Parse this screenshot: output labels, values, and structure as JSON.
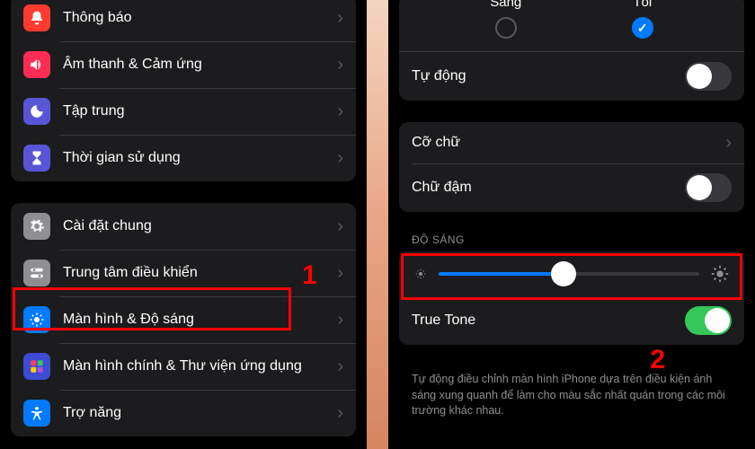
{
  "left": {
    "group1": [
      {
        "label": "Thông báo",
        "color": "#ff3b30",
        "icon": "bell"
      },
      {
        "label": "Âm thanh & Cảm ứng",
        "color": "#ff2d55",
        "icon": "speaker"
      },
      {
        "label": "Tập trung",
        "color": "#5856d6",
        "icon": "moon"
      },
      {
        "label": "Thời gian sử dụng",
        "color": "#5856d6",
        "icon": "hourglass"
      }
    ],
    "group2": [
      {
        "label": "Cài đặt chung",
        "color": "#8e8e93",
        "icon": "gear"
      },
      {
        "label": "Trung tâm điều khiển",
        "color": "#8e8e93",
        "icon": "switches"
      },
      {
        "label": "Màn hình & Độ sáng",
        "color": "#007aff",
        "icon": "brightness"
      },
      {
        "label": "Màn hình chính & Thư viện ứng dụng",
        "color": "#3e4bd3",
        "icon": "grid"
      },
      {
        "label": "Trợ năng",
        "color": "#007aff",
        "icon": "accessibility"
      }
    ]
  },
  "right": {
    "appearance": {
      "light": "Sáng",
      "dark": "Tối",
      "selected": "dark"
    },
    "auto_label": "Tự động",
    "auto_value": false,
    "text_size_label": "Cỡ chữ",
    "bold_label": "Chữ đậm",
    "bold_value": false,
    "brightness_header": "ĐỘ SÁNG",
    "brightness_value": 48,
    "truetone_label": "True Tone",
    "truetone_value": true,
    "truetone_footer": "Tự động điều chỉnh màn hình iPhone dựa trên điều kiện ánh sáng xung quanh để làm cho màu sắc nhất quán trong các môi trường khác nhau."
  },
  "annotations": {
    "step1": "1",
    "step2": "2"
  }
}
